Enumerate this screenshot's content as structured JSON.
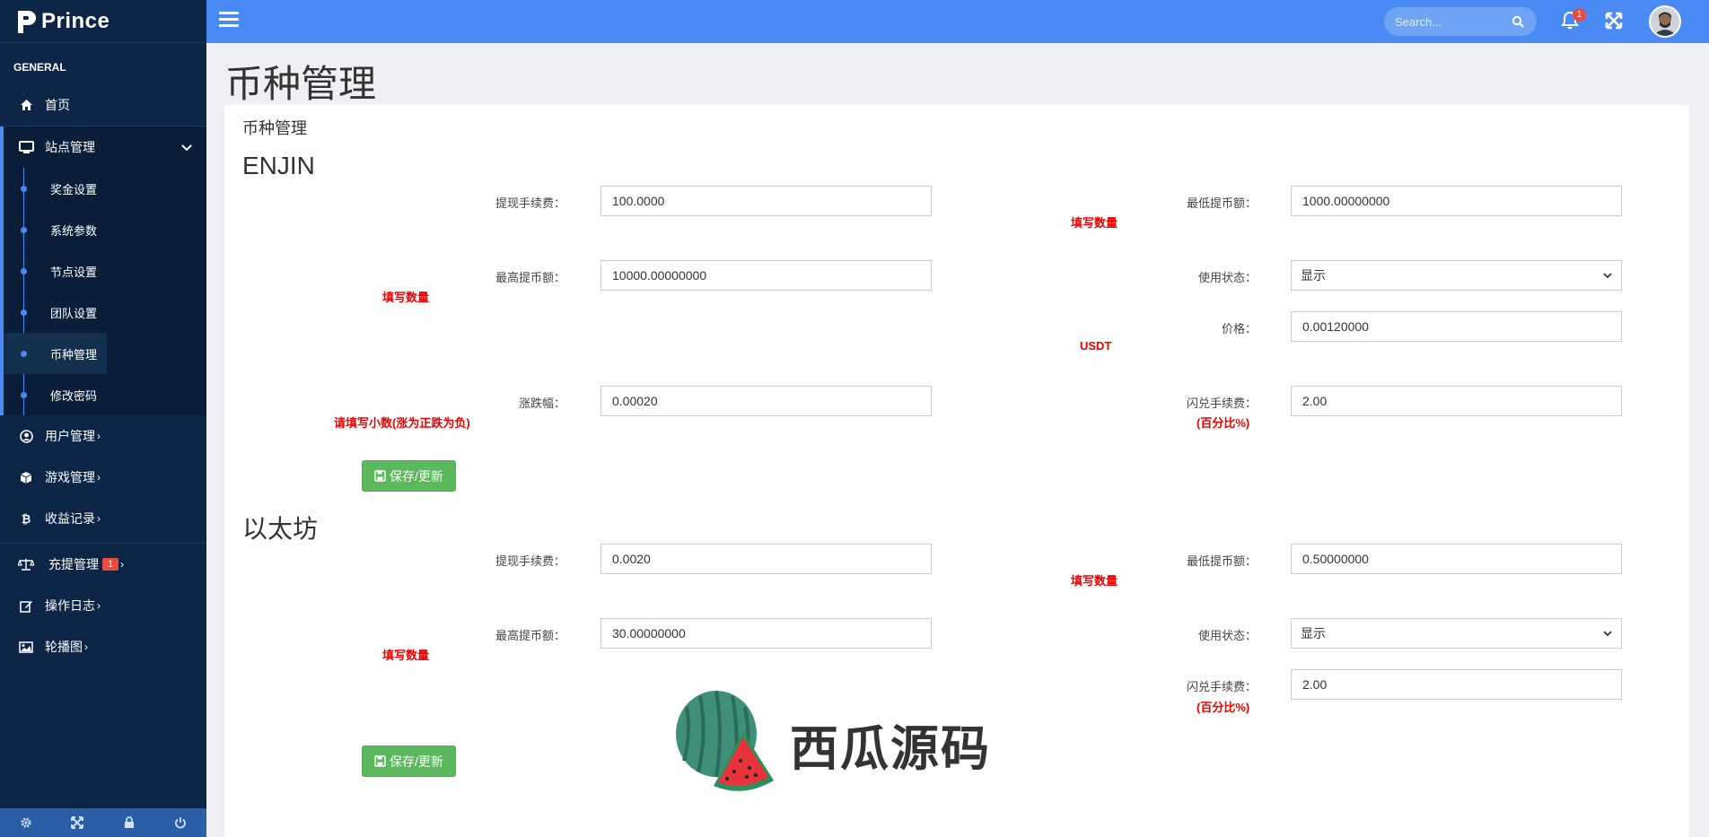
{
  "brand": {
    "name": "Prince"
  },
  "sidebar": {
    "section": "GENERAL",
    "home": "首页",
    "site_mgmt": "站点管理",
    "sub_items": [
      "奖金设置",
      "系统参数",
      "节点设置",
      "团队设置",
      "币种管理",
      "修改密码"
    ],
    "active_sub": "币种管理",
    "user_mgmt": "用户管理",
    "game_mgmt": "游戏管理",
    "income": "收益记录",
    "recharge": "充提管理",
    "recharge_badge": "1",
    "oplog": "操作日志",
    "carousel": "轮播图"
  },
  "topbar": {
    "search_placeholder": "Search...",
    "notify_count": "1"
  },
  "page": {
    "title": "币种管理",
    "card_title": "币种管理"
  },
  "coins": [
    {
      "name": "ENJIN",
      "withdraw_fee_label": "提现手续费：",
      "withdraw_fee": "100.0000",
      "min_withdraw_label": "最低提币额：",
      "min_withdraw": "1000.00000000",
      "min_hint": "填写数量",
      "max_withdraw_label": "最高提币额：",
      "max_withdraw": "10000.00000000",
      "max_hint": "填写数量",
      "status_label": "使用状态：",
      "status": "显示",
      "price_label": "价格：",
      "price": "0.00120000",
      "price_unit": "USDT",
      "change_label": "涨跌幅：",
      "change": "0.00020",
      "change_hint": "请填写小数(涨为正跌为负)",
      "swap_fee_label": "闪兑手续费：",
      "swap_fee": "2.00",
      "swap_hint": "(百分比%)",
      "save_label": "保存/更新"
    },
    {
      "name": "以太坊",
      "withdraw_fee_label": "提现手续费：",
      "withdraw_fee": "0.0020",
      "min_withdraw_label": "最低提币额：",
      "min_withdraw": "0.50000000",
      "min_hint": "填写数量",
      "max_withdraw_label": "最高提币额：",
      "max_withdraw": "30.00000000",
      "max_hint": "填写数量",
      "status_label": "使用状态：",
      "status": "显示",
      "swap_fee_label": "闪兑手续费：",
      "swap_fee": "2.00",
      "swap_hint": "(百分比%)",
      "save_label": "保存/更新"
    }
  ],
  "watermark": {
    "text": "西瓜源码"
  },
  "colors": {
    "sidebar": "#0d2547",
    "topbar": "#4a8af4",
    "accent": "#4a8af4",
    "save": "#5cb85c",
    "hint": "#ee0000"
  }
}
